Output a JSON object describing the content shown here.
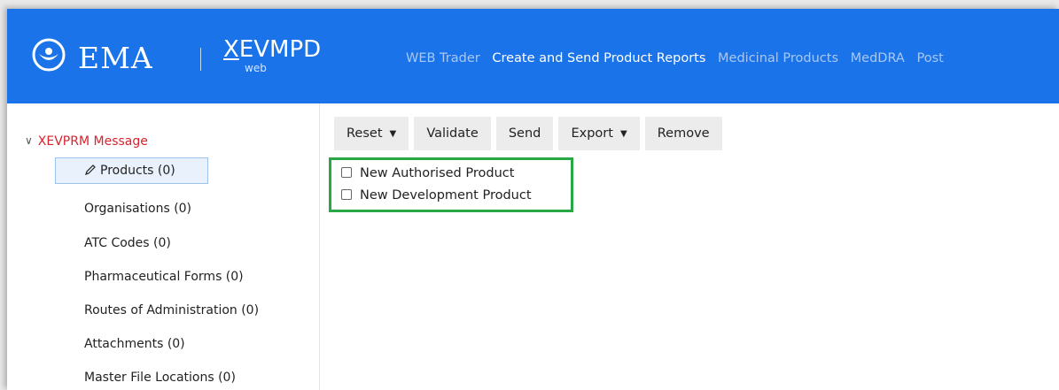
{
  "header": {
    "logo_text": "EMA",
    "app_name": "XEVMPD",
    "app_sub": "web",
    "nav": [
      {
        "label": "WEB Trader",
        "active": false
      },
      {
        "label": "Create and Send Product Reports",
        "active": true
      },
      {
        "label": "Medicinal Products",
        "active": false
      },
      {
        "label": "MedDRA",
        "active": false
      },
      {
        "label": "Post",
        "active": false
      }
    ]
  },
  "sidebar": {
    "root_label": "XEVPRM Message",
    "items": [
      {
        "label": "Products (0)",
        "selected": true
      },
      {
        "label": "Organisations (0)"
      },
      {
        "label": "ATC Codes (0)"
      },
      {
        "label": "Pharmaceutical Forms (0)"
      },
      {
        "label": "Routes of Administration (0)"
      },
      {
        "label": "Attachments (0)"
      },
      {
        "label": "Master File Locations (0)"
      }
    ]
  },
  "toolbar": {
    "reset_label": "Reset",
    "validate_label": "Validate",
    "send_label": "Send",
    "export_label": "Export",
    "remove_label": "Remove"
  },
  "new_product": {
    "authorised_label": "New Authorised Product",
    "development_label": "New Development Product",
    "authorised_checked": false,
    "development_checked": false
  },
  "colors": {
    "header_bg": "#1a73e8",
    "tree_root": "#d9232e",
    "highlight_border": "#27a844"
  }
}
